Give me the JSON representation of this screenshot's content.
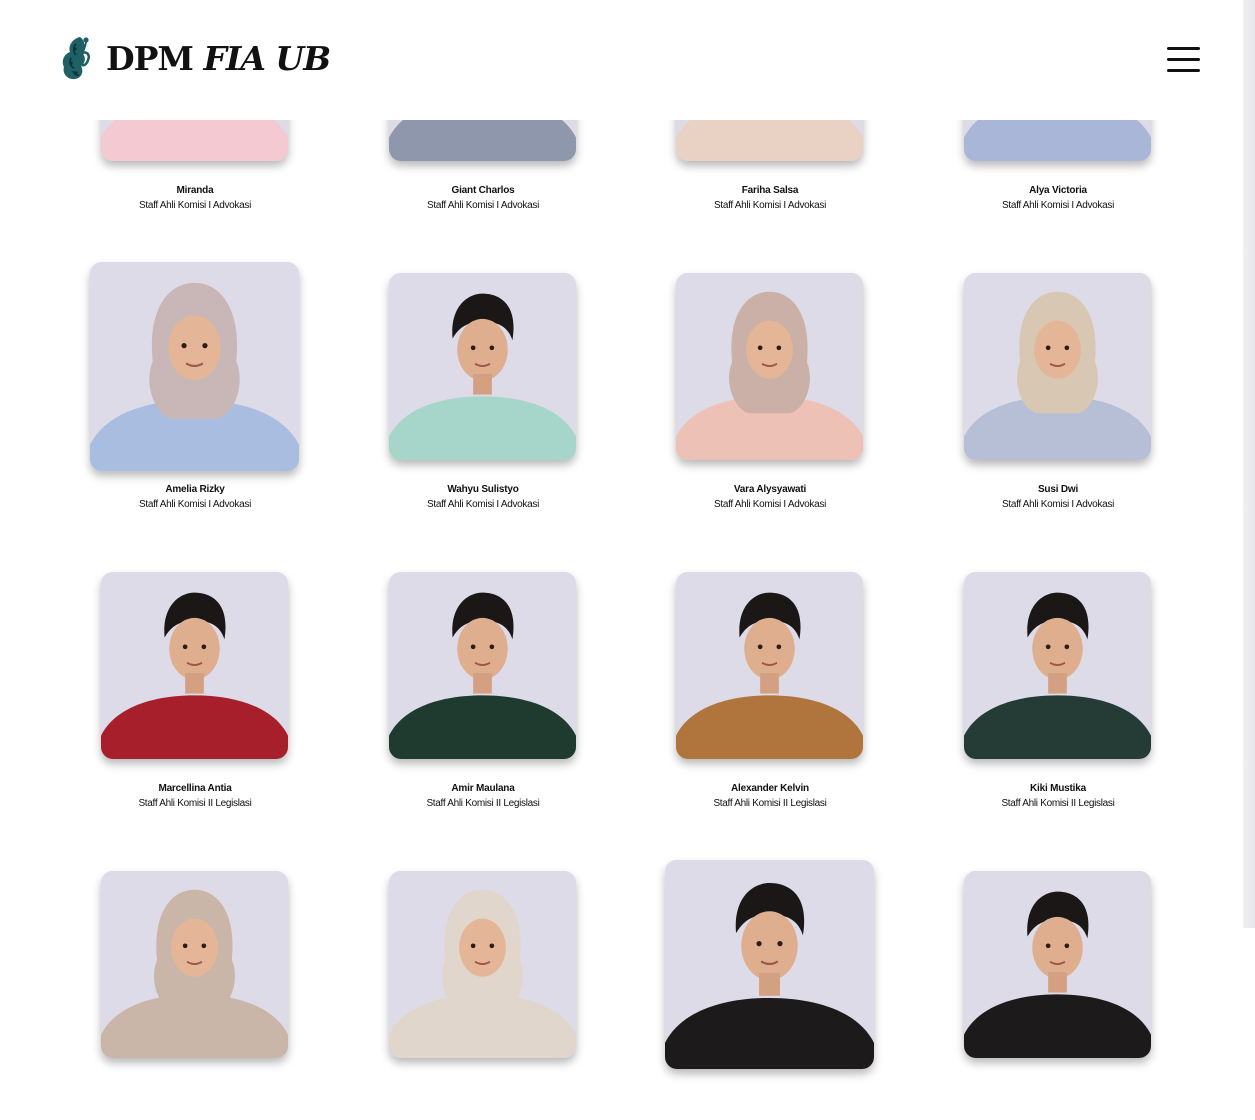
{
  "brand": {
    "prefix": "DPM",
    "suffix": "FIA UB"
  },
  "menu_icon": "hamburger-menu-icon",
  "members": [
    {
      "name": "Miranda",
      "role": "Staff Ahli Komisi I Advokasi",
      "shirt": "#f4c9d2",
      "scarf": "#b9a7a6",
      "hijab": true
    },
    {
      "name": "Giant Charlos",
      "role": "Staff Ahli Komisi I Advokasi",
      "shirt": "#8f97ad",
      "scarf": "#f1f1f5",
      "hijab": false
    },
    {
      "name": "Fariha Salsa",
      "role": "Staff Ahli Komisi I Advokasi",
      "shirt": "#e9d2c4",
      "scarf": "#e3b8c0",
      "hijab": true
    },
    {
      "name": "Alya Victoria",
      "role": "Staff Ahli Komisi I Advokasi",
      "shirt": "#a9b6d8",
      "scarf": "#bfa9b2",
      "hijab": true
    },
    {
      "name": "Amelia Rizky",
      "role": "Staff Ahli Komisi I Advokasi",
      "shirt": "#a9bde0",
      "scarf": "#c8b7b6",
      "hijab": true
    },
    {
      "name": "Wahyu Sulistyo",
      "role": "Staff Ahli Komisi I Advokasi",
      "shirt": "#a6d5c9",
      "scarf": "#1b1a1a",
      "hijab": false
    },
    {
      "name": "Vara Alysyawati",
      "role": "Staff Ahli Komisi I Advokasi",
      "shirt": "#eec1b6",
      "scarf": "#cbb0a8",
      "hijab": true
    },
    {
      "name": "Susi Dwi",
      "role": "Staff Ahli Komisi I Advokasi",
      "shirt": "#b7bfd6",
      "scarf": "#d8c7b2",
      "hijab": true
    },
    {
      "name": "Marcellina Antia",
      "role": "Staff Ahli Komisi II Legislasi",
      "shirt": "#a61f2a",
      "scarf": "#151313",
      "hijab": false
    },
    {
      "name": "Amir Maulana",
      "role": "Staff Ahli Komisi II Legislasi",
      "shirt": "#1f3a2e",
      "scarf": "#1a1616",
      "hijab": false
    },
    {
      "name": "Alexander Kelvin",
      "role": "Staff Ahli Komisi II Legislasi",
      "shirt": "#b0753c",
      "scarf": "#181515",
      "hijab": false
    },
    {
      "name": "Kiki Mustika",
      "role": "Staff Ahli Komisi II Legislasi",
      "shirt": "#253c36",
      "scarf": "#2a1c17",
      "hijab": false
    },
    {
      "name": "",
      "role": "",
      "shirt": "#c9b6a8",
      "scarf": "#c9b6a8",
      "hijab": true
    },
    {
      "name": "",
      "role": "",
      "shirt": "#e1d6cc",
      "scarf": "#e1d6cc",
      "hijab": true
    },
    {
      "name": "",
      "role": "",
      "shirt": "#1c1a1a",
      "scarf": "#1c1a1a",
      "hijab": false
    },
    {
      "name": "",
      "role": "",
      "shirt": "#1c1a1a",
      "scarf": "#1c1a1a",
      "hijab": false
    }
  ]
}
